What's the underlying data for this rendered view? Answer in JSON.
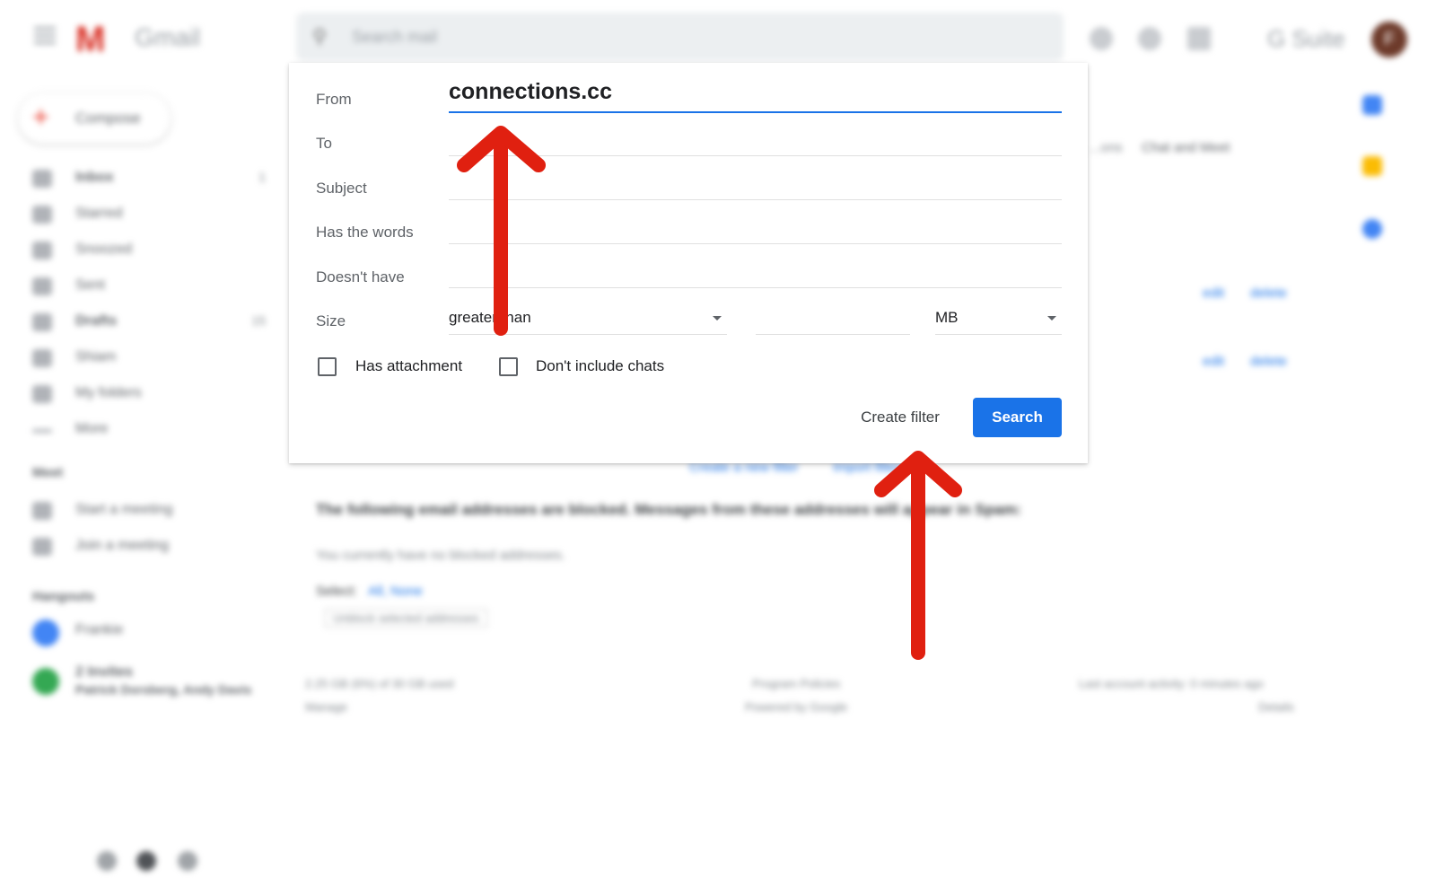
{
  "app": {
    "logo_text": "Gmail",
    "search_placeholder": "Search mail",
    "suite_label": "G Suite",
    "avatar_initial": "F",
    "colors": {
      "accent": "#1a73e8",
      "arrow": "#e02010",
      "logo": "#d93025"
    }
  },
  "sidebar": {
    "compose_label": "Compose",
    "items": [
      {
        "label": "Inbox",
        "count": "1",
        "icon": "inbox-icon"
      },
      {
        "label": "Starred",
        "count": "",
        "icon": "star-icon"
      },
      {
        "label": "Snoozed",
        "count": "",
        "icon": "clock-icon"
      },
      {
        "label": "Sent",
        "count": "",
        "icon": "send-icon"
      },
      {
        "label": "Drafts",
        "count": "15",
        "icon": "draft-icon"
      },
      {
        "label": "Shiam",
        "count": "",
        "icon": "label-icon"
      },
      {
        "label": "My folders",
        "count": "",
        "icon": "folder-icon"
      },
      {
        "label": "More",
        "count": "",
        "icon": "chevron-down-icon"
      }
    ],
    "meet_heading": "Meet",
    "meet_items": [
      "Start a meeting",
      "Join a meeting"
    ],
    "hangouts_heading": "Hangouts",
    "hangouts_user": "Frankie",
    "hangouts_group_title": "2 Invites",
    "hangouts_group_sub": "Patrick Dorsberg, Andy Davis"
  },
  "background": {
    "tabs_hint": "...ons",
    "tab_chat": "Chat and Meet",
    "edit": "edit",
    "delete": "delete",
    "create_filter_link": "Create a new filter",
    "import_link": "Import filters",
    "blocked_heading": "The following email addresses are blocked. Messages from these addresses will appear in Spam:",
    "no_blocked": "You currently have no blocked addresses.",
    "select_label": "Select:",
    "select_all_none": "All, None",
    "unblock_btn": "Unblock selected addresses",
    "storage_used": "2.25 GB (6%) of 30 GB used",
    "storage_manage": "Manage",
    "program_policies": "Program Policies",
    "powered_by": "Powered by Google",
    "last_activity": "Last account activity: 0 minutes ago",
    "details": "Details"
  },
  "filter_dialog": {
    "from_label": "From",
    "from_value": "connections.cc",
    "to_label": "To",
    "subject_label": "Subject",
    "has_words_label": "Has the words",
    "doesnt_have_label": "Doesn't have",
    "size_label": "Size",
    "size_operator": "greater than",
    "size_unit": "MB",
    "has_attachment_label": "Has attachment",
    "no_chats_label": "Don't include chats",
    "create_filter_label": "Create filter",
    "search_label": "Search"
  }
}
